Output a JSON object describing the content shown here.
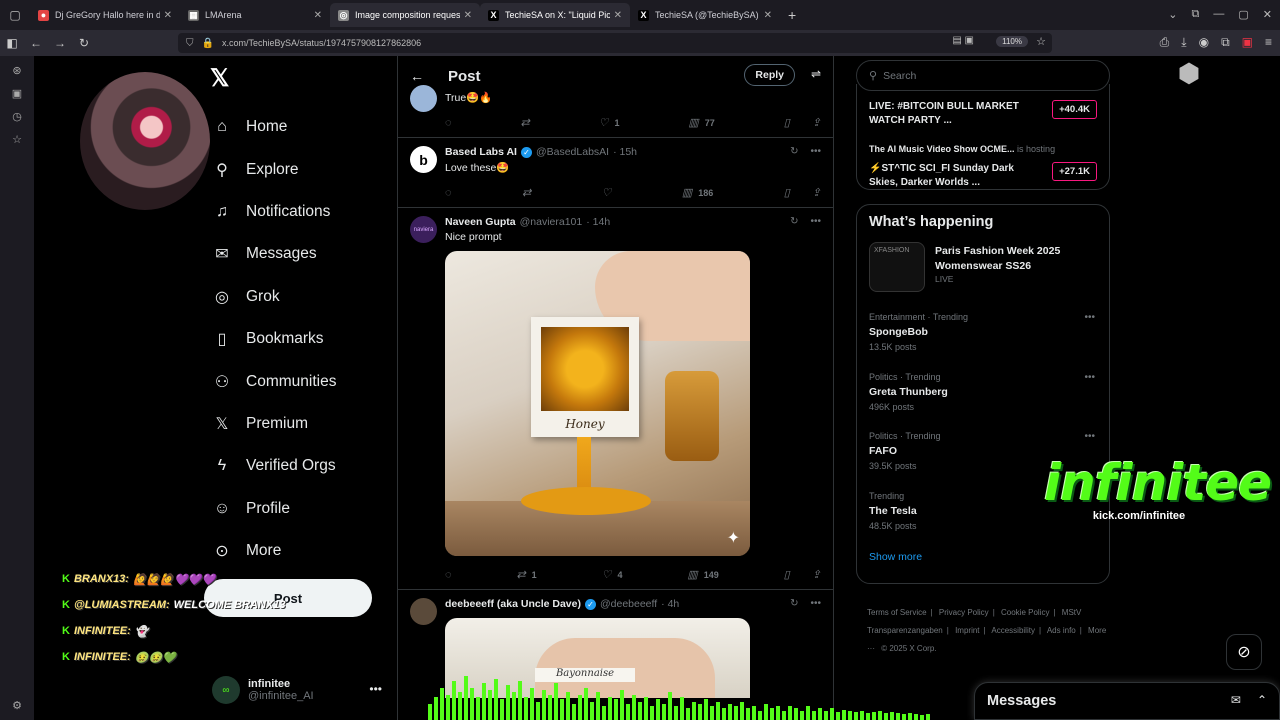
{
  "browser": {
    "tabs": [
      {
        "title": "Dj GreGory Hallo here in da H",
        "fav_color": "#e34444",
        "fav": "●"
      },
      {
        "title": "LMArena",
        "fav_color": "#666666",
        "fav": "▦"
      },
      {
        "title": "Image composition request",
        "fav_color": "#888888",
        "fav": "◎"
      },
      {
        "title": "TechieSA on X: \"Liquid Pictures",
        "fav_color": "#000000",
        "fav": "X"
      },
      {
        "title": "TechieSA (@TechieBySA) / X",
        "fav_color": "#000000",
        "fav": "X"
      }
    ],
    "url": "x.com/TechieBySA/status/1974757908127862806",
    "zoom": "110%"
  },
  "left_nav": {
    "items": [
      {
        "label": "Home",
        "icon": "⌂"
      },
      {
        "label": "Explore",
        "icon": "⚲"
      },
      {
        "label": "Notifications",
        "icon": "🔔"
      },
      {
        "label": "Messages",
        "icon": "✉"
      },
      {
        "label": "Grok",
        "icon": "◎"
      },
      {
        "label": "Bookmarks",
        "icon": "▯"
      },
      {
        "label": "Communities",
        "icon": "👥"
      },
      {
        "label": "Premium",
        "icon": "X"
      },
      {
        "label": "Verified Orgs",
        "icon": "ϟ"
      },
      {
        "label": "Profile",
        "icon": "👤"
      },
      {
        "label": "More",
        "icon": "⋯"
      }
    ],
    "post_label": "Post",
    "account": {
      "name": "infinitee",
      "handle": "@infinitee_AI"
    }
  },
  "chat": [
    {
      "name": "BRANX13:",
      "msg": "🙋🙋🙋💜💜💜"
    },
    {
      "name": "@LUMIASTREAM:",
      "msg": "WELCOME BRANX13"
    },
    {
      "name": "INFINITEE:",
      "msg": "👻"
    },
    {
      "name": "INFINITEE:",
      "msg": "🤢🤢💚"
    }
  ],
  "column": {
    "title": "Post",
    "reply_label": "Reply",
    "posts": [
      {
        "name": "",
        "handle": "",
        "time": "",
        "text": "True🤩🔥",
        "replies": "",
        "reposts": "",
        "likes": "1",
        "views": "77"
      },
      {
        "name": "Based Labs AI",
        "handle": "@BasedLabsAI",
        "time": "· 15h",
        "text": "Love these🤩",
        "replies": "",
        "reposts": "",
        "likes": "",
        "views": "186"
      },
      {
        "name": "Naveen Gupta",
        "handle": "@naviera101",
        "time": "· 14h",
        "text": "Nice prompt",
        "replies": "",
        "reposts": "1",
        "likes": "4",
        "views": "149",
        "image_caption": "Honey"
      },
      {
        "name": "deebeeeff (aka Uncle Dave)",
        "handle": "@deebeeeff",
        "time": "· 4h",
        "text": "",
        "image_caption": "Bayonnaise"
      }
    ]
  },
  "right": {
    "search_placeholder": "Search",
    "live": [
      {
        "title": "LIVE: #BITCOIN BULL MARKET WATCH PARTY ...",
        "count": "+40.4K"
      },
      {
        "host": "The AI Music Video Show OCME...",
        "host_suffix": "is hosting",
        "title": "⚡ST^TIC SCI_FI Sunday Dark Skies, Darker Worlds ...",
        "count": "+27.1K"
      }
    ],
    "whats_happening": "What’s happening",
    "featured": {
      "title": "Paris Fashion Week 2025 Womenswear SS26",
      "status": "LIVE",
      "thumb_text": "XFASHION"
    },
    "trends": [
      {
        "category": "Entertainment · Trending",
        "name": "SpongeBob",
        "posts": "13.5K posts"
      },
      {
        "category": "Politics · Trending",
        "name": "Greta Thunberg",
        "posts": "496K posts"
      },
      {
        "category": "Politics · Trending",
        "name": "FAFO",
        "posts": "39.5K posts"
      },
      {
        "category": "Trending",
        "name": "The Tesla",
        "posts": "48.5K posts"
      }
    ],
    "show_more": "Show more",
    "footer": [
      "Terms of Service",
      "|",
      "Privacy Policy",
      "|",
      "Cookie Policy",
      "|",
      "MStV Transparenzangaben",
      "|",
      "Imprint",
      "|",
      "Accessibility",
      "|",
      "Ads info",
      "|",
      "More ···",
      "© 2025 X Corp."
    ]
  },
  "messages_label": "Messages",
  "overlay": {
    "brand": "infinitee",
    "url": "kick.com/infinitee"
  },
  "eq_levels": [
    0.35,
    0.5,
    0.7,
    0.55,
    0.85,
    0.6,
    0.95,
    0.7,
    0.5,
    0.8,
    0.65,
    0.9,
    0.45,
    0.75,
    0.6,
    0.85,
    0.5,
    0.7,
    0.4,
    0.65,
    0.55,
    0.8,
    0.45,
    0.6,
    0.35,
    0.55,
    0.7,
    0.4,
    0.6,
    0.3,
    0.5,
    0.45,
    0.65,
    0.35,
    0.55,
    0.4,
    0.5,
    0.3,
    0.45,
    0.35,
    0.6,
    0.3,
    0.5,
    0.25,
    0.4,
    0.35,
    0.45,
    0.3,
    0.4,
    0.25,
    0.35,
    0.3,
    0.4,
    0.25,
    0.3,
    0.2,
    0.35,
    0.25,
    0.3,
    0.2,
    0.3,
    0.25,
    0.2,
    0.3,
    0.2,
    0.25,
    0.2,
    0.25,
    0.18,
    0.22,
    0.2,
    0.18,
    0.2,
    0.15,
    0.18,
    0.2,
    0.15,
    0.18,
    0.15,
    0.12,
    0.15,
    0.12,
    0.1,
    0.12
  ]
}
